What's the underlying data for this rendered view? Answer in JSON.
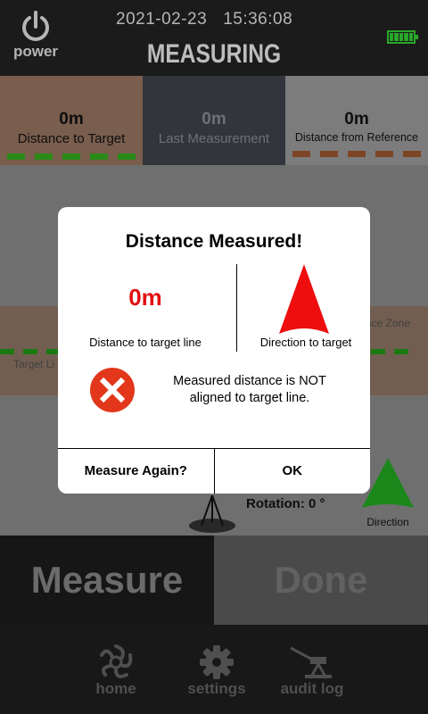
{
  "header": {
    "power_label": "power",
    "date": "2021-02-23",
    "time": "15:36:08",
    "title": "MEASURING",
    "battery_color": "#2fbf2f"
  },
  "stats": [
    {
      "value": "0m",
      "label": "Distance to Target"
    },
    {
      "value": "0m",
      "label": "Last Measurement"
    },
    {
      "value": "0m",
      "label": "Distance from Reference"
    }
  ],
  "map": {
    "target_line_label": "Target Li",
    "zone_label": "nce Zone",
    "rotation": "Rotation: 0 °",
    "direction_label": "Direction",
    "direction_color": "#1f9a1f"
  },
  "actions": {
    "measure": "Measure",
    "done": "Done"
  },
  "nav": {
    "home": "home",
    "settings": "settings",
    "audit_log": "audit log"
  },
  "dialog": {
    "title": "Distance Measured!",
    "distance_value": "0m",
    "distance_label": "Distance to target line",
    "direction_label": "Direction to target",
    "message_line1": "Measured distance is NOT",
    "message_line2": "aligned to target line.",
    "measure_again": "Measure Again?",
    "ok": "OK",
    "alert_color": "#e21212"
  }
}
